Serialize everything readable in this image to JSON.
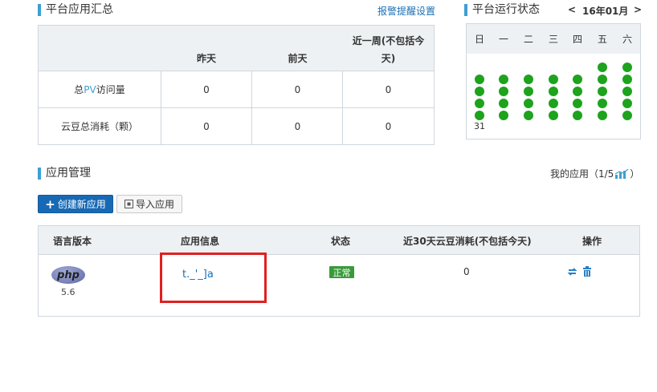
{
  "summary": {
    "title": "平台应用汇总",
    "alarm_link": "报警提醒设置",
    "columns": [
      "",
      "昨天",
      "前天",
      "近一周(不包括今天)"
    ],
    "col3_line1": "近一周(不包括今",
    "col3_line2": "天)",
    "rows": [
      {
        "label_pre": "总 ",
        "label_highlight": "PV",
        "label_post": " 访问量",
        "values": [
          "0",
          "0",
          "0"
        ]
      },
      {
        "label": "云豆总消耗（颗）",
        "values": [
          "0",
          "0",
          "0"
        ]
      }
    ]
  },
  "calendar": {
    "title": "平台运行状态",
    "prev": "<",
    "month": "16年01月",
    "next": ">",
    "weekdays": [
      "日",
      "一",
      "二",
      "三",
      "四",
      "五",
      "六"
    ],
    "last_day_label": "31",
    "status_color": "#1da31d"
  },
  "apps": {
    "title": "应用管理",
    "my_apps_label": "我的应用（1/5",
    "my_apps_suffix": "）",
    "create_button": "创建新应用",
    "import_button": "导入应用",
    "columns": [
      "语言版本",
      "应用信息",
      "状态",
      "近30天云豆消耗(不包括今天)",
      "操作"
    ],
    "rows": [
      {
        "language_logo": "php",
        "language_version": "5.6",
        "app_name": "t._'_]a",
        "status": "正常",
        "consumption": "0",
        "actions": [
          "switch-icon",
          "trash-icon"
        ]
      }
    ]
  },
  "colors": {
    "accent": "#3e9fd3",
    "link": "#1a6fb5",
    "primary_button": "#1769b4",
    "status_green": "#3a9a3a",
    "highlight_box": "#e02020"
  }
}
